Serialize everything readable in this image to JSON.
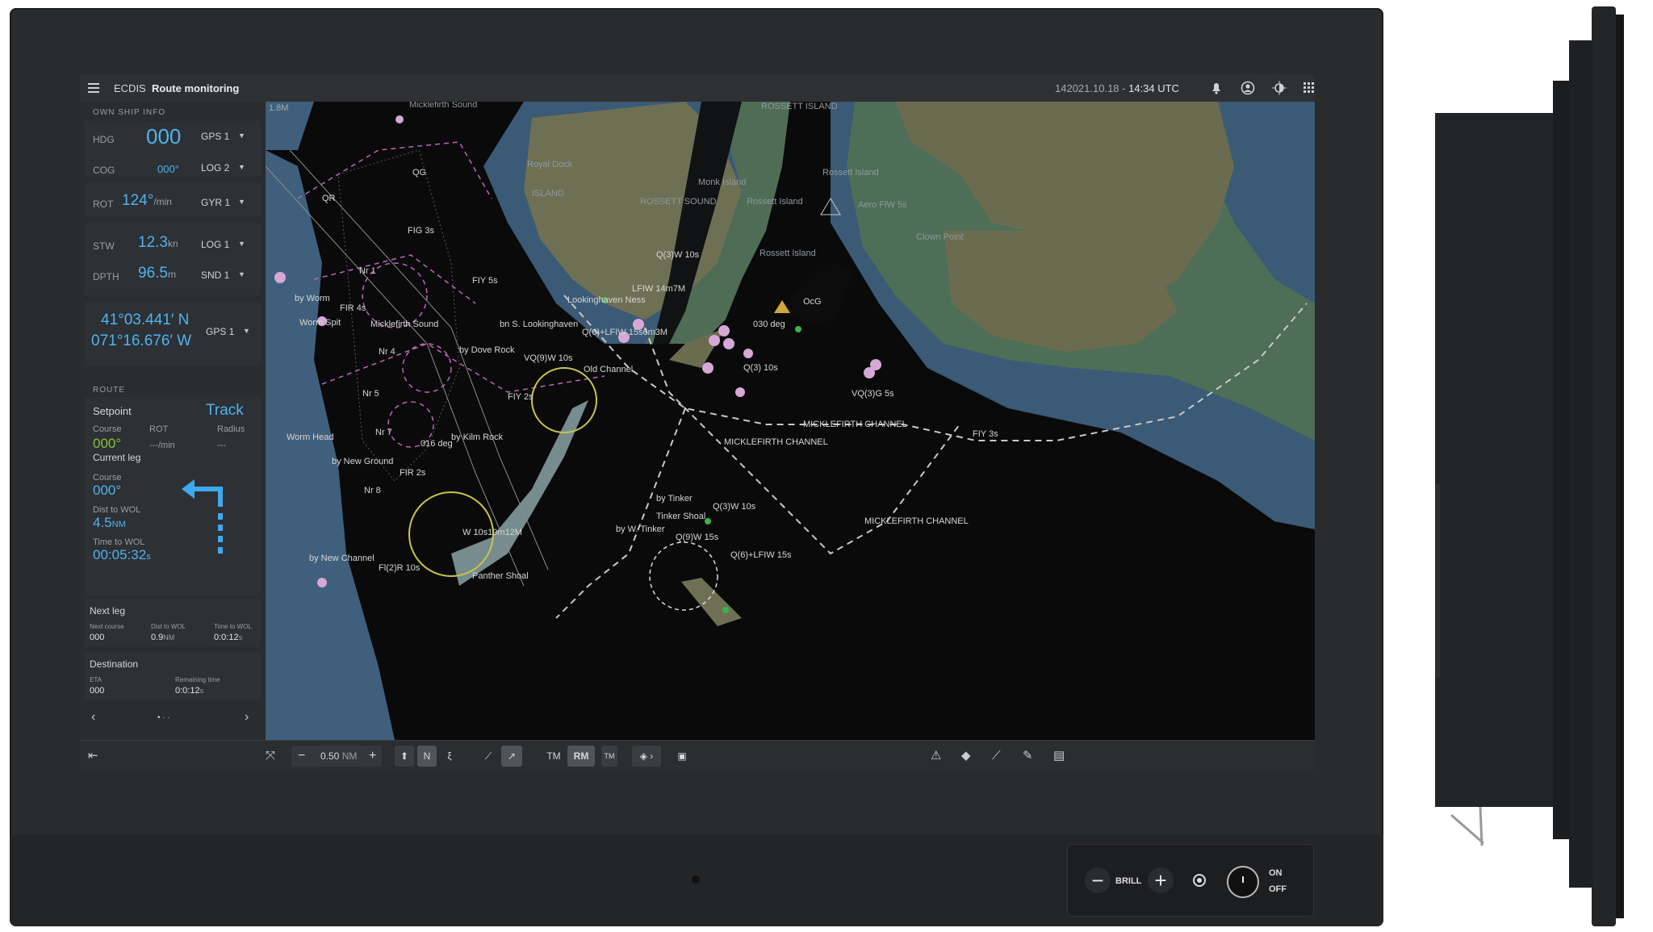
{
  "topbar": {
    "menu_icon": "hamburger-icon",
    "app_name": "ECDIS",
    "mode": "Route monitoring",
    "datetime_prefix": "142021.10.18 - ",
    "time": "14:34 UTC",
    "icons": [
      "bell-icon",
      "user-icon",
      "brightness-icon",
      "apps-grid-icon"
    ]
  },
  "own_ship": {
    "header": "OWN SHIP INFO",
    "hdg": {
      "label": "HDG",
      "value": "000",
      "source": "GPS 1"
    },
    "cog": {
      "label": "COG",
      "value": "000°",
      "source": "LOG 2"
    },
    "rot": {
      "label": "ROT",
      "value": "124°",
      "unit": "/min",
      "source": "GYR 1"
    },
    "stw": {
      "label": "STW",
      "value": "12.3",
      "unit": "kn",
      "source": "LOG 1"
    },
    "dpth": {
      "label": "DPTH",
      "value": "96.5",
      "unit": "m",
      "source": "SND 1"
    },
    "lat": "41°03.441′ N",
    "lon": "071°16.676′ W",
    "pos_source": "GPS 1"
  },
  "route": {
    "header": "ROUTE",
    "setpoint_label": "Setpoint",
    "setpoint_value": "Track",
    "course_label": "Course",
    "rot_label": "ROT",
    "radius_label": "Radius",
    "course_value": "000°",
    "rot_value": "---/min",
    "radius_value": "---",
    "current_leg_label": "Current leg",
    "cl_course_label": "Course",
    "cl_course_value": "000°",
    "dist_label": "Dist to WOL",
    "dist_value": "4.5",
    "dist_unit": "NM",
    "time_label": "Time to WOL",
    "time_value": "00:05:32",
    "time_unit": "s",
    "turn_icon": "turn-left-arrow-icon"
  },
  "next_leg": {
    "title": "Next leg",
    "c1_label": "Next course",
    "c2_label": "Dist to WOL",
    "c3_label": "Time to WOL",
    "c1_value": "000",
    "c2_value": "0.9",
    "c2_unit": "NM",
    "c3_value": "0:0:12",
    "c3_unit": "s"
  },
  "destination": {
    "title": "Destination",
    "eta_label": "ETA",
    "remaining_label": "Remaining time",
    "eta_value": "000",
    "remaining_value": "0:0:12",
    "remaining_unit": "s"
  },
  "pager": {
    "prev": "‹",
    "next": "›",
    "dots": "• · ·"
  },
  "bottombar": {
    "collapse_icon": "collapse-left-icon",
    "pin_icon": "pin-icon",
    "zoom_out": "−",
    "range": "0.50",
    "range_unit": "NM",
    "zoom_in": "+",
    "tm": "TM",
    "rm": "RM",
    "tm_sub": "TM"
  },
  "map": {
    "scale_label": "1.8M",
    "labels": {
      "michlefirth_sound_top": "Micklefirth Sound",
      "rossett_island_top": "ROSSETT ISLAND",
      "royal_dock": "Royal Dock",
      "island": "ISLAND",
      "rossett_sound": "ROSSETT SOUND",
      "monk_island": "Monk Island",
      "rossett_island_1": "Rossett Island",
      "rossett_island_2": "Rossett Island",
      "aero_flw": "Aero FlW 5s",
      "clown_point": "Clown Point",
      "rossett_island_3": "Rossett Island",
      "qg": "QG",
      "qr": "QR",
      "fig3s": "FIG 3s",
      "fig5s": "FIY 5s",
      "nr1": "Nr 1",
      "by_worm": "by Worm",
      "fir4s": "FIR 4s",
      "worm_spit": "Worm Spit",
      "micklefirth_sound": "Micklefirth Sound",
      "nr4": "Nr 4",
      "by_dove_rock": "by Dove Rock",
      "vq9w": "VQ(9)W 10s",
      "old_channel": "Old Channel",
      "q3_10s": "Q(3) 10s",
      "q3w_10s": "Q(3)W 10s",
      "lookinghaven": "Lookinghaven Ness",
      "lfw14": "LFIW 14m7M",
      "bys_looking": "bn S. Lookinghaven",
      "q6lflw": "Q(6)+LFIW 15s6m3M",
      "vq3g": "VQ(3)G 5s",
      "mick_channel_1": "MICKLEFIRTH CHANNEL",
      "mick_channel_2": "MICKLEFIRTH CHANNEL",
      "mick_channel_3": "MICKLEFIRTH CHANNEL",
      "fiy3s": "FIY 3s",
      "nr5": "Nr 5",
      "nr7": "Nr 7",
      "worm_head": "Worm Head",
      "by_new_ground": "by New Ground",
      "fir2s": "FIR 2s",
      "nr8": "Nr 8",
      "by_kilm_rock": "by Kilm Rock",
      "deg016": "016 deg",
      "deg030": "030 deg",
      "w10s": "W 10s19m12M",
      "by_new_channel": "by New Channel",
      "fl2r": "Fl(2)R 10s",
      "panther_shoal": "Panther Shoal",
      "by_tinker": "by Tinker",
      "tinker_shoal": "Tinker Shoal",
      "by_w_tinker": "by W. Tinker",
      "q9w15": "Q(9)W 15s",
      "q6lflw15": "Q(6)+LFIW 15s",
      "q3w10b": "Q(3)W 10s",
      "ocg": "OcG",
      "fiy2s": "FIY 2s"
    }
  },
  "control_panel": {
    "minus": "−",
    "brill": "BRILL",
    "plus": "+",
    "on": "ON",
    "off": "OFF",
    "power_icon": "power-icon",
    "palette_icon": "palette-icon"
  }
}
